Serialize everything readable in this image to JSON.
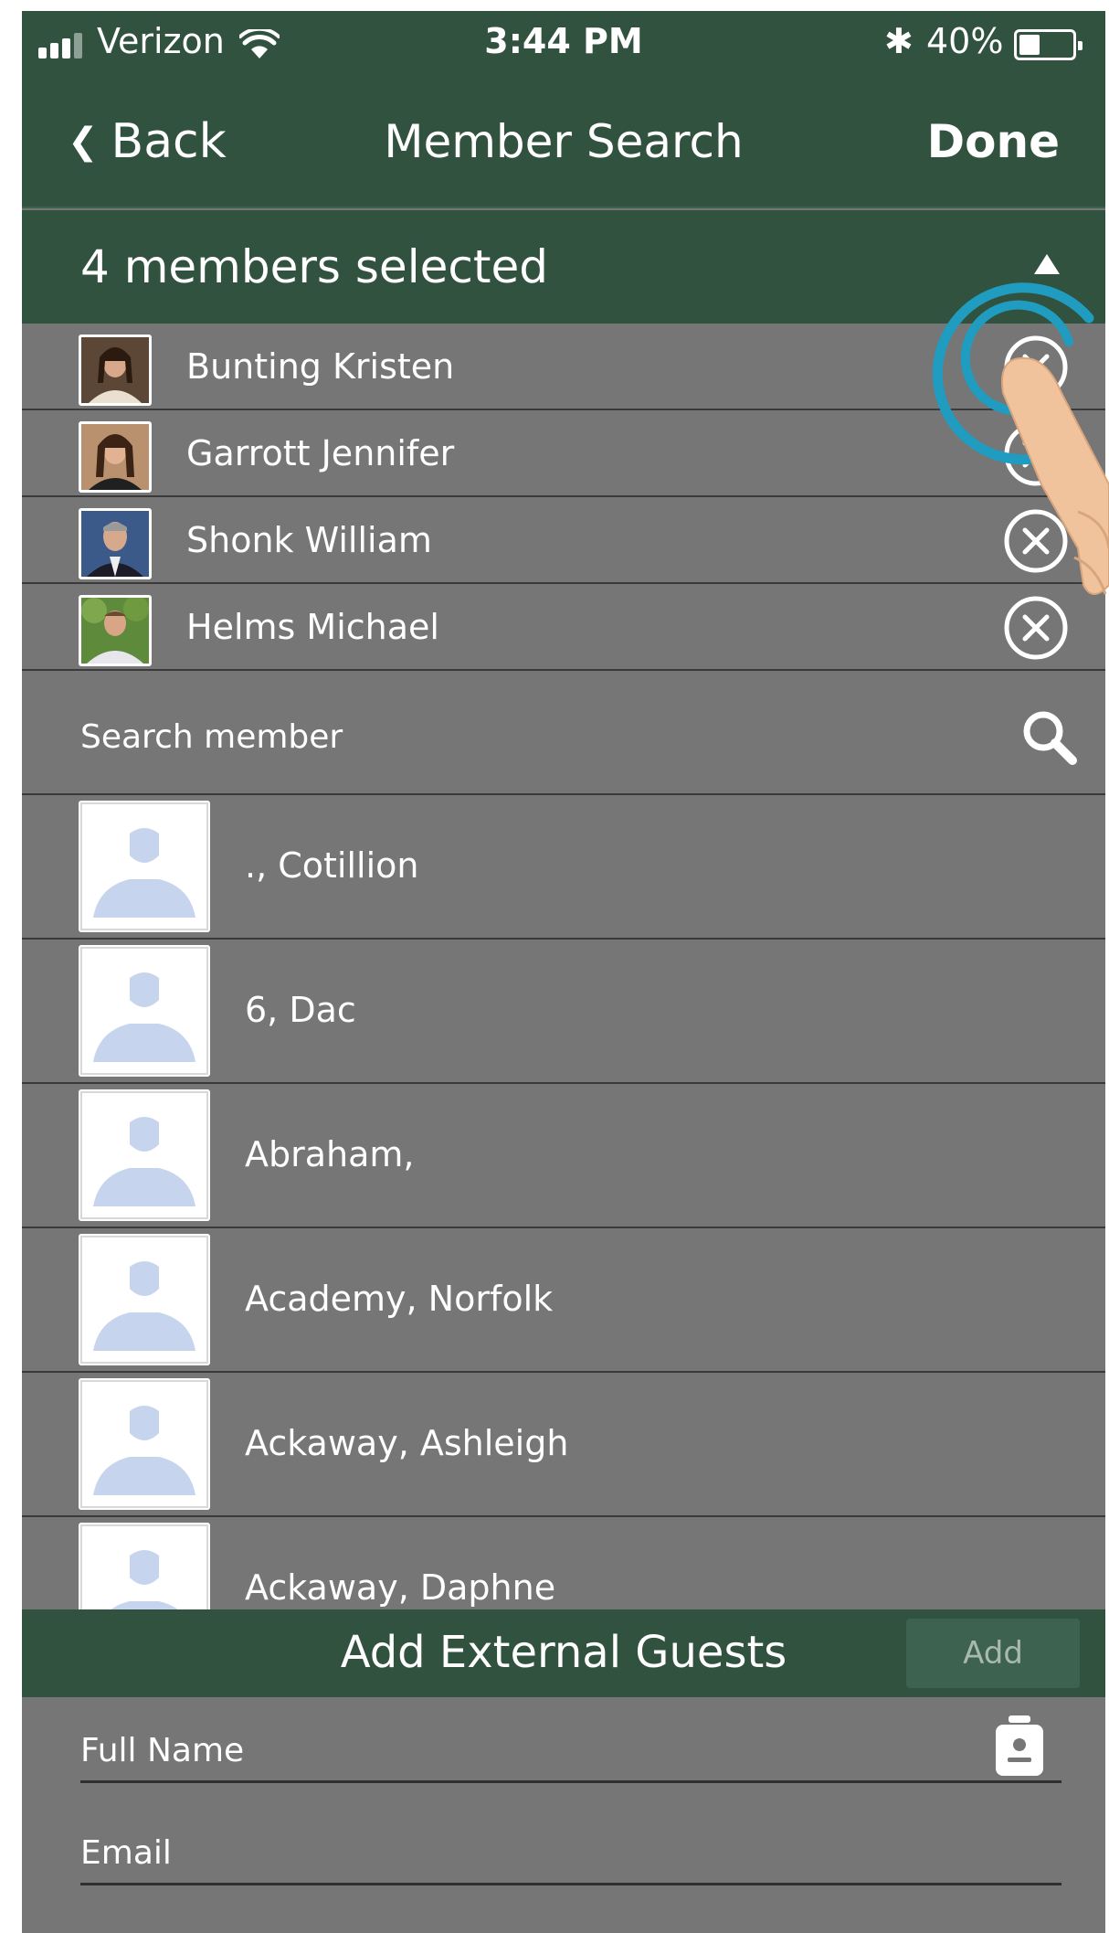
{
  "status_bar": {
    "carrier": "Verizon",
    "time": "3:44 PM",
    "battery": "40%",
    "battery_level": 0.4,
    "icons": [
      "signal-icon",
      "wifi-icon",
      "bluetooth-icon",
      "battery-icon"
    ]
  },
  "nav": {
    "back_label": "Back",
    "title": "Member Search",
    "done_label": "Done"
  },
  "selected": {
    "header": "4 members selected",
    "items": [
      {
        "name": "Bunting Kristen"
      },
      {
        "name": "Garrott Jennifer"
      },
      {
        "name": "Shonk William"
      },
      {
        "name": "Helms Michael"
      }
    ]
  },
  "search": {
    "placeholder": "Search member"
  },
  "results": [
    {
      "name": "., Cotillion"
    },
    {
      "name": "6, Dac"
    },
    {
      "name": "Abraham,"
    },
    {
      "name": "Academy, Norfolk"
    },
    {
      "name": "Ackaway, Ashleigh"
    },
    {
      "name": "Ackaway, Daphne"
    }
  ],
  "external_guests": {
    "title": "Add External Guests",
    "add_label": "Add",
    "full_name_placeholder": "Full Name",
    "email_placeholder": "Email"
  },
  "colors": {
    "header_green": "#31523f",
    "panel_gray": "#767676",
    "accent_teal": "#1f9cc0"
  }
}
